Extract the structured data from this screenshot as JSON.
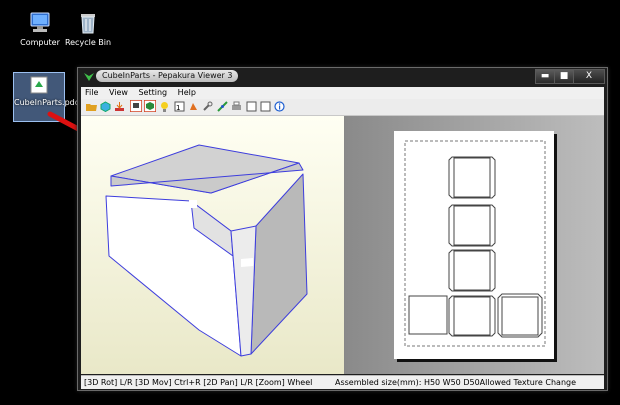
{
  "desktop": {
    "icons": [
      {
        "label": "Computer"
      },
      {
        "label": "Recycle Bin"
      },
      {
        "label": "CubeInParts.pdo"
      }
    ]
  },
  "window": {
    "title": "CubeInParts - Pepakura Viewer 3",
    "menu": [
      "File",
      "View",
      "Setting",
      "Help"
    ],
    "controls": {
      "minimize": "▬",
      "maximize": "■",
      "close": "X"
    }
  },
  "status": {
    "left": "[3D Rot] L/R [3D Mov] Ctrl+R [2D Pan] L/R [Zoom] Wheel",
    "right": "Assembled size(mm): H50 W50 D50Allowed Texture Change"
  },
  "colors": {
    "desktop": "#000000",
    "pane3d": "#fbfbe8",
    "edges": "#3d3ddd",
    "arrow": "#dd1111"
  }
}
